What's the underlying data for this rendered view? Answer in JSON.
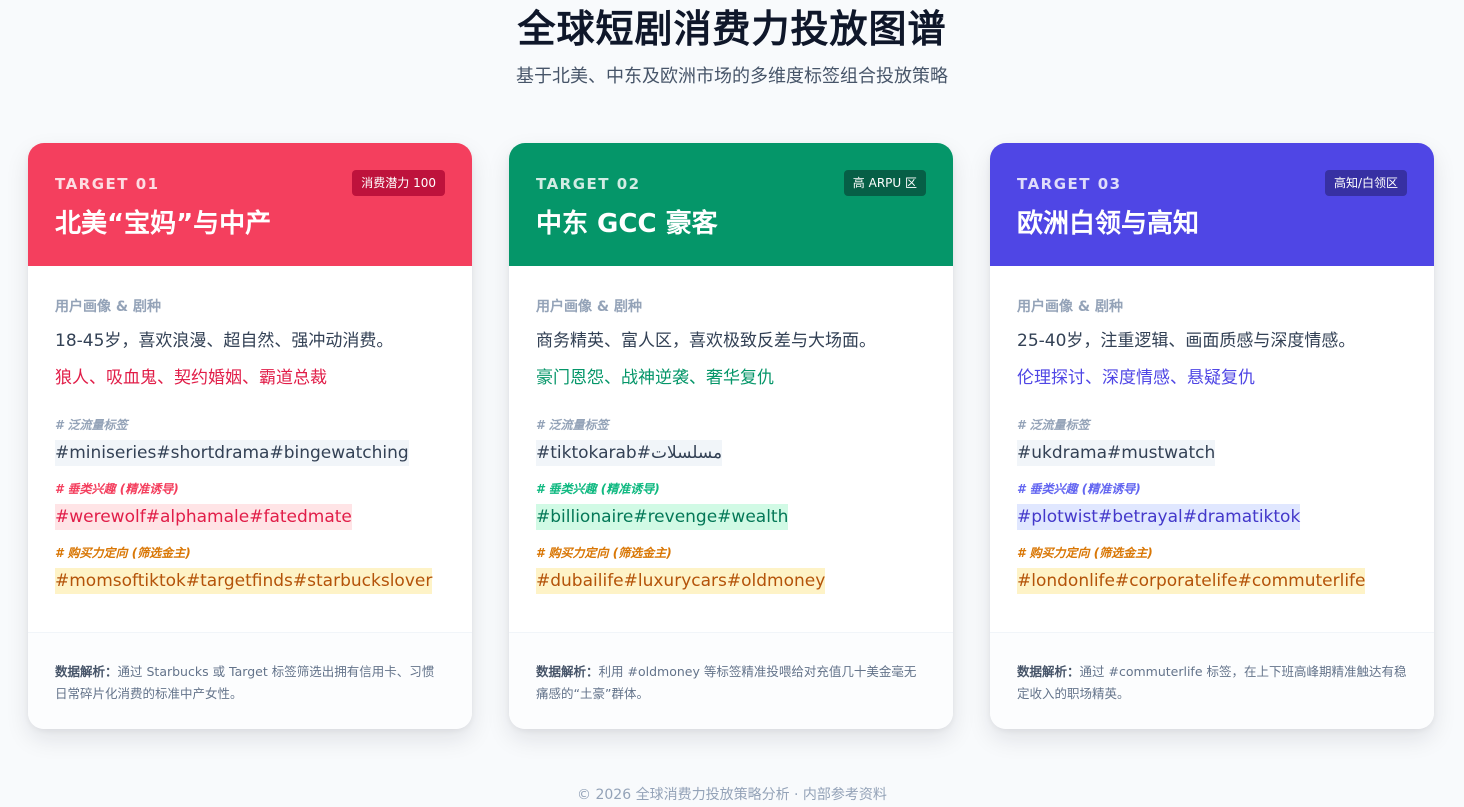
{
  "page": {
    "title": "全球短剧消费力投放图谱",
    "subtitle": "基于北美、中东及欧洲市场的多维度标签组合投放策略"
  },
  "colors": {
    "north_america": "#f43f5e",
    "middle_east": "#059669",
    "europe": "#4f46e5",
    "purchase_tag": "#d97706"
  },
  "cards": [
    {
      "target": "TARGET 01",
      "badge": "消费潜力 100",
      "title": "北美“宝妈”与中产",
      "profile_label": "用户画像 & 剧种",
      "profile": "18-45岁，喜欢浪漫、超自然、强冲动消费。",
      "genres": "狼人、吸血鬼、契约婚姻、霸道总裁",
      "broad_label": "# 泛流量标签",
      "broad_tags": "#miniseries#shortdrama#bingewatching",
      "niche_label": "# 垂类兴趣 (精准诱导)",
      "niche_tags": "#werewolf#alphamale#fatedmate",
      "buy_label": "# 购买力定向 (筛选金主)",
      "buy_tags": "#momsoftiktok#targetfinds#starbuckslover",
      "analysis_label": "数据解析：",
      "analysis": "通过 Starbucks 或 Target 标签筛选出拥有信用卡、习惯日常碎片化消费的标准中产女性。"
    },
    {
      "target": "TARGET 02",
      "badge": "高 ARPU 区",
      "title": "中东 GCC 豪客",
      "profile_label": "用户画像 & 剧种",
      "profile": "商务精英、富人区，喜欢极致反差与大场面。",
      "genres": "豪门恩怨、战神逆袭、奢华复仇",
      "broad_label": "# 泛流量标签",
      "broad_tags": "#tiktokarab#مسلسلات",
      "niche_label": "# 垂类兴趣 (精准诱导)",
      "niche_tags": "#billionaire#revenge#wealth",
      "buy_label": "# 购买力定向 (筛选金主)",
      "buy_tags": "#dubailife#luxurycars#oldmoney",
      "analysis_label": "数据解析：",
      "analysis": "利用 #oldmoney 等标签精准投喂给对充值几十美金毫无痛感的“土豪”群体。"
    },
    {
      "target": "TARGET 03",
      "badge": "高知/白领区",
      "title": "欧洲白领与高知",
      "profile_label": "用户画像 & 剧种",
      "profile": "25-40岁，注重逻辑、画面质感与深度情感。",
      "genres": "伦理探讨、深度情感、悬疑复仇",
      "broad_label": "# 泛流量标签",
      "broad_tags": "#ukdrama#mustwatch",
      "niche_label": "# 垂类兴趣 (精准诱导)",
      "niche_tags": "#plotwist#betrayal#dramatiktok",
      "buy_label": "# 购买力定向 (筛选金主)",
      "buy_tags": "#londonlife#corporatelife#commuterlife",
      "analysis_label": "数据解析：",
      "analysis": "通过 #commuterlife 标签，在上下班高峰期精准触达有稳定收入的职场精英。"
    }
  ],
  "footer": "© 2026 全球消费力投放策略分析 · 内部参考资料"
}
